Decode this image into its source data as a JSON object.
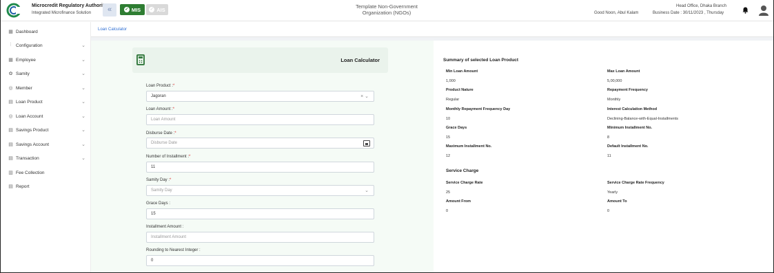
{
  "header": {
    "org_name": "Microcredit Regulatory Authority",
    "org_sub": "Integrated Microfinance Solution",
    "collapse_icon": "double-chevron-left-icon",
    "mis_label": "MIS",
    "ais_label": "AIS",
    "center_title_line1": "Template Non-Government",
    "center_title_line2": "Organization (NGOs)",
    "greeting": "Good Noon, Abul Kalam",
    "branch": "Head Office, Dhaka Branch",
    "business_date": "Business Date : 30/11/2023 , Thursday"
  },
  "sidebar": {
    "items": [
      {
        "label": "Dashboard",
        "icon": "grid-icon",
        "chevron": false
      },
      {
        "label": "Configuration",
        "icon": "sliders-icon",
        "chevron": true
      },
      {
        "label": "Employee",
        "icon": "users-icon",
        "chevron": true
      },
      {
        "label": "Samity",
        "icon": "group-icon",
        "chevron": true
      },
      {
        "label": "Member",
        "icon": "member-icon",
        "chevron": true
      },
      {
        "label": "Loan Product",
        "icon": "loan-product-icon",
        "chevron": true
      },
      {
        "label": "Loan Account",
        "icon": "loan-account-icon",
        "chevron": true
      },
      {
        "label": "Savings Product",
        "icon": "savings-product-icon",
        "chevron": true
      },
      {
        "label": "Savings Account",
        "icon": "savings-account-icon",
        "chevron": true
      },
      {
        "label": "Transaction",
        "icon": "transaction-icon",
        "chevron": true
      },
      {
        "label": "Fee Collection",
        "icon": "fee-icon",
        "chevron": false
      },
      {
        "label": "Report",
        "icon": "report-icon",
        "chevron": false
      }
    ]
  },
  "breadcrumb": "Loan Calculator",
  "form": {
    "title": "Loan Calculator",
    "loan_product": {
      "label": "Loan Product :",
      "value": "Jagoran"
    },
    "loan_amount": {
      "label": "Loan Amount :",
      "placeholder": "Loan Amount"
    },
    "disburse_date": {
      "label": "Disburse Date :",
      "placeholder": "Disburse Date"
    },
    "num_installment": {
      "label": "Number of Installment :",
      "value": "11"
    },
    "samity_day": {
      "label": "Samity Day :",
      "placeholder": "Samity Day"
    },
    "grace_days": {
      "label": "Grace Days :",
      "value": "15"
    },
    "installment_amount": {
      "label": "Installment Amount :",
      "placeholder": "Installment Amount"
    },
    "rounding": {
      "label": "Rounding to Nearest Integer :",
      "value": "0"
    },
    "required_mark": "*",
    "clear_glyph": "×",
    "dropdown_glyph": "⌄"
  },
  "summary": {
    "title": "Summary of selected Loan Product",
    "min_loan_amount": {
      "label": "Min Loan Amount",
      "value": "1,000"
    },
    "max_loan_amount": {
      "label": "Max Loan Amount",
      "value": "5,00,000"
    },
    "product_nature": {
      "label": "Product Nature",
      "value": "Regular"
    },
    "repayment_frequency": {
      "label": "Repayment Frequency",
      "value": "Monthly"
    },
    "monthly_repayment_day": {
      "label": "Monthly Repayment Frequency Day",
      "value": "10"
    },
    "interest_method": {
      "label": "Interest Calculation Method",
      "value": "Declining-Balance-with-Equal-Installments"
    },
    "grace_days": {
      "label": "Grace Days",
      "value": "15"
    },
    "min_installment": {
      "label": "Minimum Installment No.",
      "value": "8"
    },
    "max_installment": {
      "label": "Maximum Installment No.",
      "value": "12"
    },
    "default_installment": {
      "label": "Default Installment No.",
      "value": "11"
    },
    "service_charge_title": "Service Charge",
    "service_charge_rate": {
      "label": "Service Charge Rate",
      "value": "25"
    },
    "service_charge_freq": {
      "label": "Service Charge Rate Frequency",
      "value": "Yearly"
    },
    "amount_from": {
      "label": "Amount From",
      "value": "0"
    },
    "amount_to": {
      "label": "Amount To",
      "value": "0"
    }
  },
  "colors": {
    "brand_green": "#2e7d32",
    "link_blue": "#2f6fd3",
    "form_bg": "#f5fbf6"
  }
}
